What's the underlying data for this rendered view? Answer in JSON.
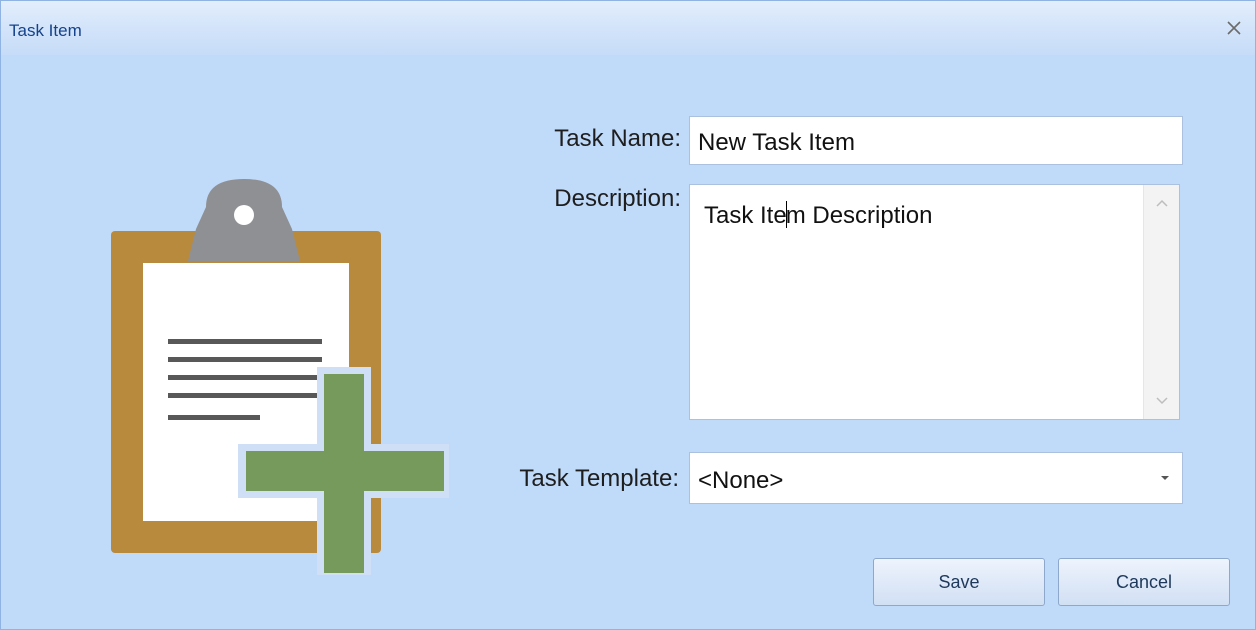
{
  "window": {
    "title": "Task Item",
    "close_icon": "close-icon"
  },
  "illustration": {
    "icon": "clipboard-add-icon",
    "colors": {
      "board": "#b88a3e",
      "paper": "#ffffff",
      "clip": "#8f9093",
      "lines": "#585858",
      "plus": "#759a5b"
    }
  },
  "form": {
    "task_name": {
      "label": "Task Name:",
      "value": "New Task Item"
    },
    "description": {
      "label": "Description:",
      "value_before_caret": "Task Ite",
      "value_after_caret": "m Description"
    },
    "task_template": {
      "label": "Task Template:",
      "selected": "<None>"
    }
  },
  "buttons": {
    "save": "Save",
    "cancel": "Cancel"
  },
  "colors": {
    "background": "#c0daf9",
    "title_text": "#15428b"
  }
}
